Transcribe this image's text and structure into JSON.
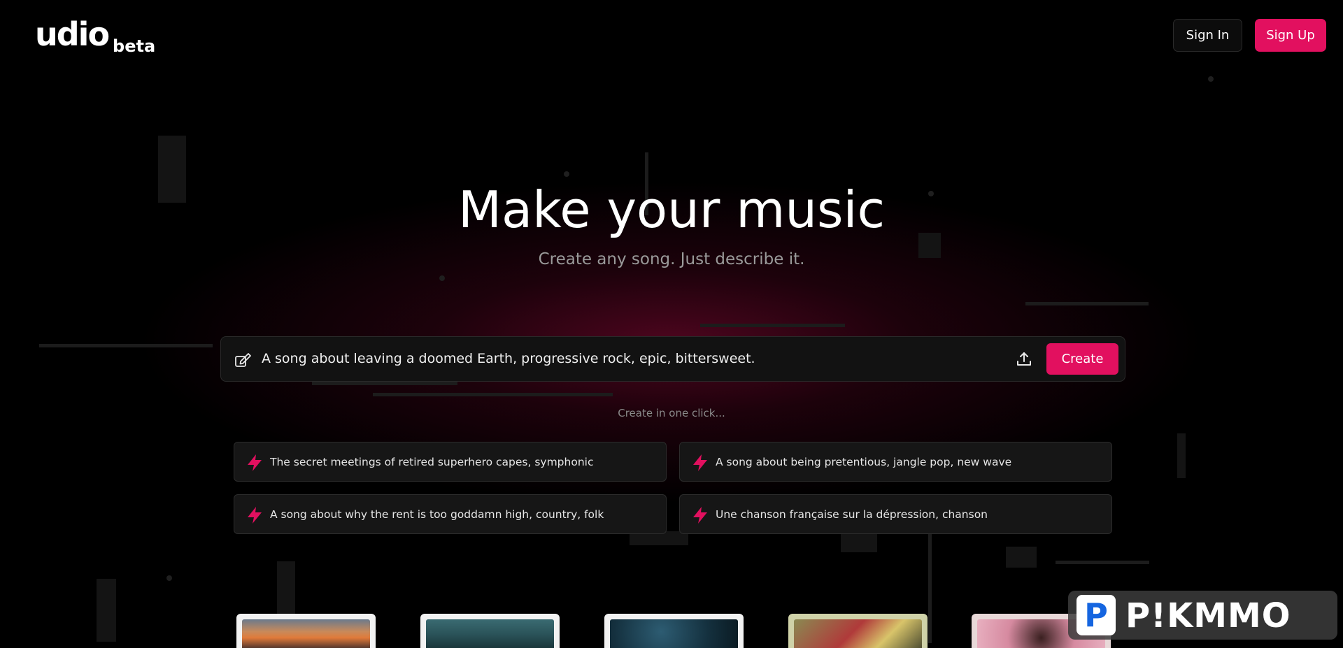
{
  "brand": {
    "name": "udio",
    "tag": "beta"
  },
  "header": {
    "sign_in_label": "Sign In",
    "sign_up_label": "Sign Up"
  },
  "hero": {
    "title": "Make your music",
    "subtitle": "Create any song. Just describe it."
  },
  "prompt": {
    "value": "A song about leaving a doomed Earth, progressive rock, epic, bittersweet.",
    "create_label": "Create",
    "icons": [
      "edit-prompt-icon",
      "upload-icon"
    ]
  },
  "suggestions": {
    "heading": "Create in one click...",
    "items": [
      {
        "label": "The secret meetings of retired superhero capes, symphonic"
      },
      {
        "label": "A song about being pretentious, jangle pop, new wave"
      },
      {
        "label": "A song about why the rent is too goddamn high, country, folk"
      },
      {
        "label": "Une chanson française sur la dépression, chanson"
      }
    ]
  },
  "watermark": {
    "letter": "P",
    "text": "P!KMMO"
  },
  "colors": {
    "accent": "#e2105f",
    "background": "#000000",
    "surface": "#161616"
  }
}
